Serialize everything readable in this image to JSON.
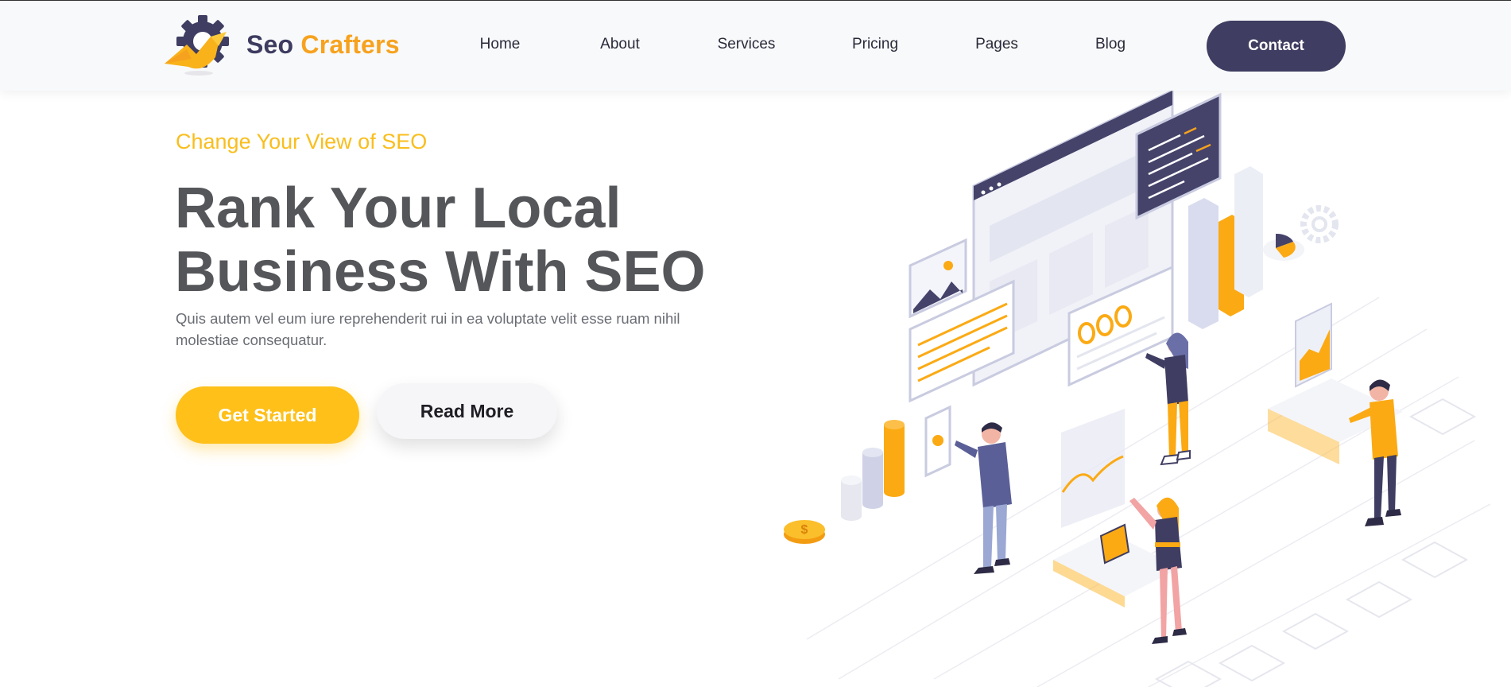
{
  "brand": {
    "name_part1": "Seo",
    "name_part2": "Crafters"
  },
  "nav": {
    "items": [
      {
        "label": "Home"
      },
      {
        "label": "About"
      },
      {
        "label": "Services"
      },
      {
        "label": "Pricing"
      },
      {
        "label": "Pages"
      },
      {
        "label": "Blog"
      }
    ],
    "contact_label": "Contact"
  },
  "hero": {
    "eyebrow": "Change Your View of SEO",
    "headline_line1": "Rank Your Local",
    "headline_line2": "Business With SEO",
    "description": "Quis autem vel eum iure reprehenderit rui in ea voluptate velit esse ruam nihil molestiae consequatur.",
    "primary_button": "Get Started",
    "secondary_button": "Read More"
  },
  "colors": {
    "accent_yellow": "#fec019",
    "eyebrow_yellow": "#f9be1d",
    "brand_orange": "#f7a21e",
    "navy": "#3f3d61",
    "heading_gray": "#545659",
    "body_gray": "#6a6d74"
  },
  "icons": {
    "logo": "gear-rocket-logo-icon",
    "coin": "dollar-coin-icon"
  }
}
